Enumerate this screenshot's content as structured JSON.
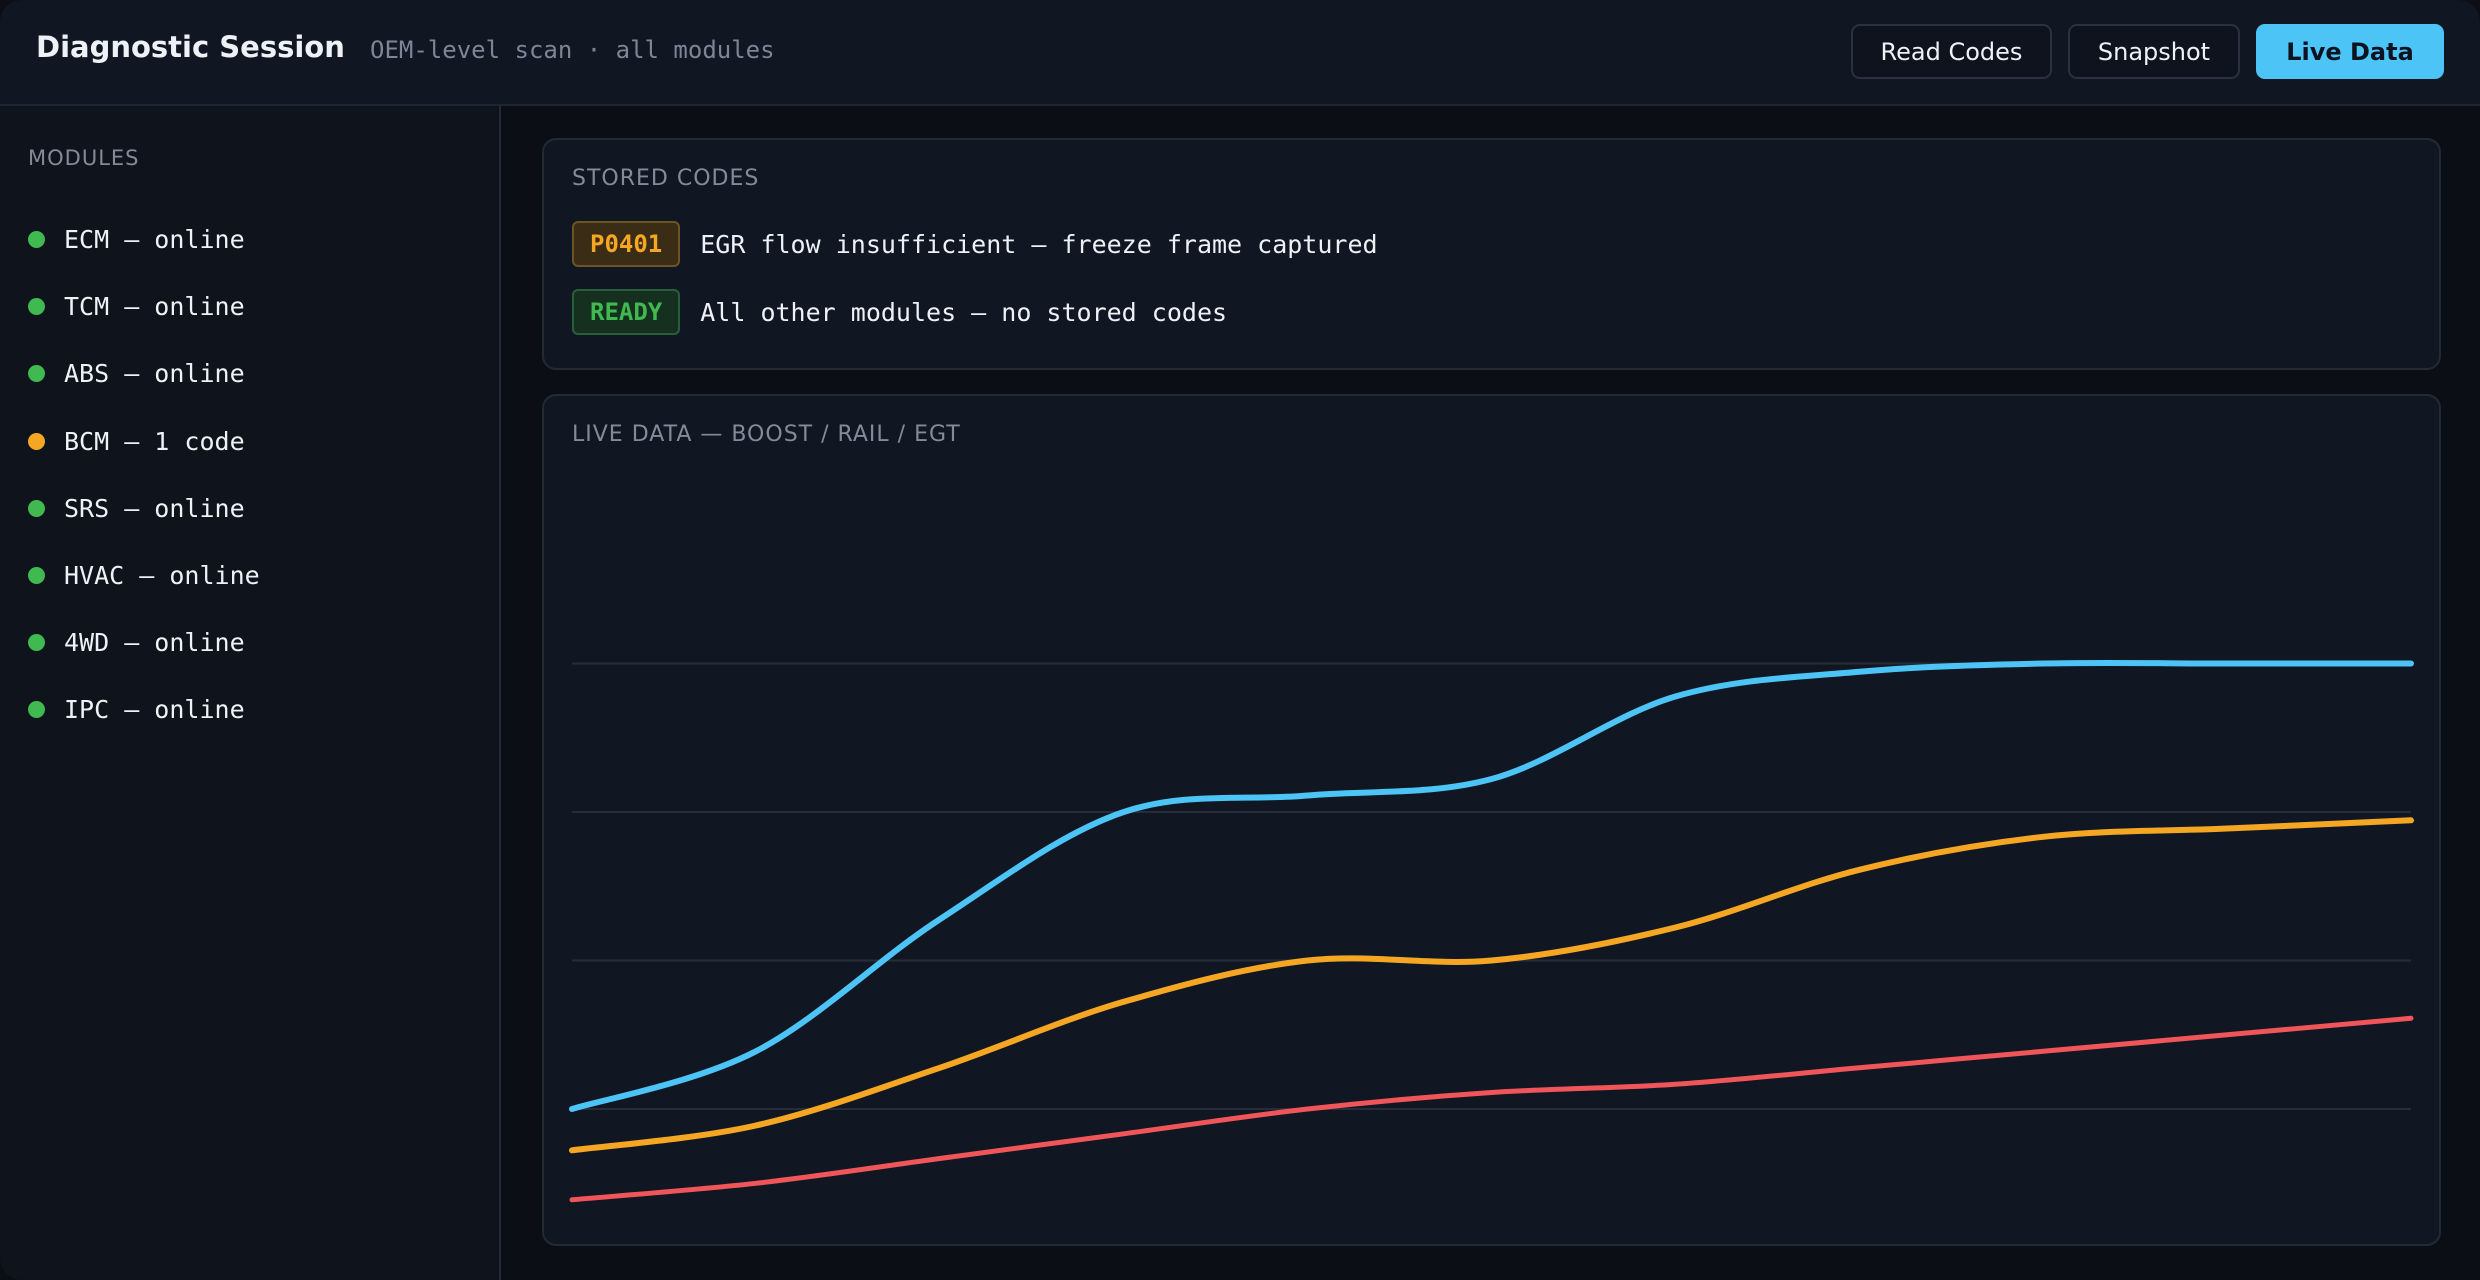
{
  "header": {
    "title": "Diagnostic Session",
    "subtitle": "OEM-level scan · all modules",
    "buttons": {
      "read_codes": "Read Codes",
      "snapshot": "Snapshot",
      "live_data": "Live Data"
    }
  },
  "sidebar": {
    "heading": "MODULES",
    "modules": [
      {
        "label": "ECM — online",
        "status": "online"
      },
      {
        "label": "TCM — online",
        "status": "online"
      },
      {
        "label": "ABS — online",
        "status": "online"
      },
      {
        "label": "BCM — 1 code",
        "status": "warning"
      },
      {
        "label": "SRS — online",
        "status": "online"
      },
      {
        "label": "HVAC — online",
        "status": "online"
      },
      {
        "label": "4WD — online",
        "status": "online"
      },
      {
        "label": "IPC — online",
        "status": "online"
      }
    ]
  },
  "stored_codes": {
    "title": "STORED CODES",
    "rows": [
      {
        "badge": "P0401",
        "text": "EGR flow insufficient — freeze frame captured",
        "kind": "warn"
      },
      {
        "badge": "READY",
        "text": "All other modules — no stored codes",
        "kind": "ok"
      }
    ]
  },
  "live_panel": {
    "title": "LIVE DATA — BOOST / RAIL / EGT"
  },
  "colors": {
    "online": "#3fb950",
    "warning": "#f5a623",
    "accent": "#4cc4f5",
    "boost": "#4cc4f5",
    "rail": "#f5a623",
    "egt": "#f0555a",
    "grid": "#262d3a"
  },
  "chart_data": {
    "type": "line",
    "title": "LIVE DATA — BOOST / RAIL / EGT",
    "xlabel": "",
    "ylabel": "",
    "xlim": [
      0,
      10
    ],
    "ylim": [
      0,
      100
    ],
    "grid": true,
    "gridlines_y": [
      70,
      52,
      34,
      16
    ],
    "x": [
      0,
      1,
      2,
      3,
      4,
      5,
      6,
      7,
      8,
      9,
      10
    ],
    "series": [
      {
        "key": "boost",
        "values": [
          16,
          23,
          39,
          52,
          54,
          56,
          66,
          69,
          70,
          70,
          70
        ]
      },
      {
        "key": "rail",
        "values": [
          11,
          14,
          21,
          29,
          34,
          34,
          38,
          45,
          49,
          50,
          51
        ]
      },
      {
        "key": "egt",
        "values": [
          5,
          7,
          10,
          13,
          16,
          18,
          19,
          21,
          23,
          25,
          27
        ]
      }
    ]
  }
}
